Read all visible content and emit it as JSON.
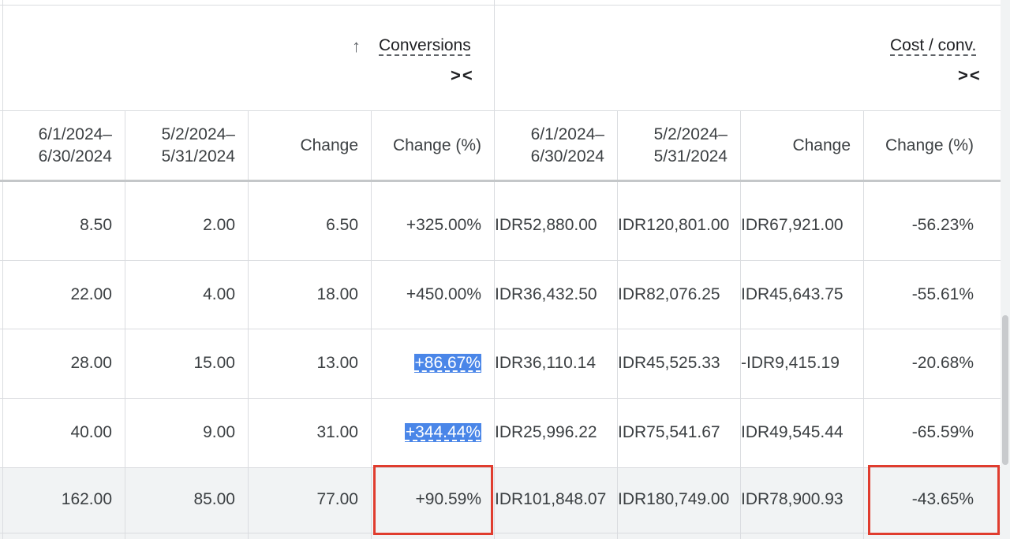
{
  "headers": {
    "conversions_label": "Conversions",
    "cost_conv_label": "Cost / conv.",
    "sort_arrow": "↑",
    "collapse_glyph": "><"
  },
  "columns": [
    {
      "line1": "6/1/2024–",
      "line2": "6/30/2024"
    },
    {
      "line1": "5/2/2024–",
      "line2": "5/31/2024"
    },
    {
      "line1": "Change",
      "line2": ""
    },
    {
      "line1": "Change (%)",
      "line2": ""
    },
    {
      "line1": "6/1/2024–",
      "line2": "6/30/2024"
    },
    {
      "line1": "5/2/2024–",
      "line2": "5/31/2024"
    },
    {
      "line1": "Change",
      "line2": ""
    },
    {
      "line1": "Change (%)",
      "line2": ""
    }
  ],
  "rows": [
    [
      "8.50",
      "2.00",
      "6.50",
      "+325.00%",
      "IDR52,880.00",
      "IDR120,801.00",
      "IDR67,921.00",
      "-56.23%"
    ],
    [
      "22.00",
      "4.00",
      "18.00",
      "+450.00%",
      "IDR36,432.50",
      "IDR82,076.25",
      "IDR45,643.75",
      "-55.61%"
    ],
    [
      "28.00",
      "15.00",
      "13.00",
      "+86.67%",
      "IDR36,110.14",
      "IDR45,525.33",
      "-IDR9,415.19",
      "-20.68%"
    ],
    [
      "40.00",
      "9.00",
      "31.00",
      "+344.44%",
      "IDR25,996.22",
      "IDR75,541.67",
      "IDR49,545.44",
      "-65.59%"
    ],
    [
      "162.00",
      "85.00",
      "77.00",
      "+90.59%",
      "IDR101,848.07",
      "IDR180,749.00",
      "IDR78,900.93",
      "-43.65%"
    ]
  ],
  "highlighted_cells": [
    "2-3",
    "3-3"
  ],
  "colors": {
    "highlight": "#4a86e8",
    "annotation_box": "#e03c2e",
    "grid": "#dadce0",
    "total_row_bg": "#f1f3f4"
  }
}
